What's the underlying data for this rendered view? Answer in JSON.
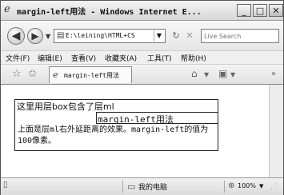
{
  "window": {
    "title": "margin-left用法 - Windows Internet E...",
    "minimize": "_",
    "maximize": "□",
    "close": "✕"
  },
  "nav": {
    "back_glyph": "◀",
    "forward_glyph": "▶",
    "dropdown_glyph": "▼",
    "address": "E:\\leining\\HTML+CS",
    "refresh_glyph": "↻",
    "stop_glyph": "✕",
    "search_placeholder": "Live Search"
  },
  "menu": {
    "items": [
      "文件(F)",
      "编辑(E)",
      "查看(V)",
      "收藏夹(A)",
      "工具(T)",
      "帮助(H)"
    ]
  },
  "tabs": {
    "active_label": "margin-left用法"
  },
  "page": {
    "outer_text": "这里用层box包含了层ml",
    "inner_text": "margin-left用法",
    "description": "上面是层ml右外延距离的效果。margin-left的值为100像素。"
  },
  "status": {
    "zone": "我的电脑",
    "zoom": "100%"
  },
  "colors": {
    "chrome": "#f2f2f2",
    "border": "#555555",
    "content_bg": "#ffffff"
  },
  "icons": {
    "browser": "ie-logo-icon",
    "favorites": "star-icon",
    "add_favorite": "add-favorite-icon",
    "home": "home-icon",
    "feeds": "feeds-icon",
    "zone": "computer-icon",
    "zoom": "magnifier-icon"
  }
}
